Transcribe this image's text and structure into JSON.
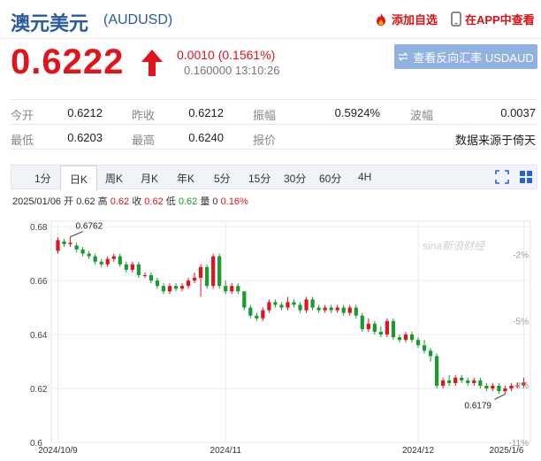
{
  "header": {
    "name": "澳元美元",
    "code": "(AUDUSD)",
    "add_favorite": "添加自选",
    "view_in_app": "在APP中查看"
  },
  "quote": {
    "price": "0.6222",
    "change": "0.0010 (0.1561%)",
    "time": "0.160000 13:10:26",
    "reverse_button": "查看反向汇率 USDAUD",
    "accent_color": "#e1141c"
  },
  "stats": [
    [
      {
        "label": "今开",
        "value": "0.6212"
      },
      {
        "label": "昨收",
        "value": "0.6212"
      },
      {
        "label": "振幅",
        "value": "0.5924%"
      },
      {
        "label": "波幅",
        "value": "0.0037"
      }
    ],
    [
      {
        "label": "最低",
        "value": "0.6203"
      },
      {
        "label": "最高",
        "value": "0.6240"
      },
      {
        "label": "报价",
        "value": ""
      },
      {
        "label": "",
        "value": "数据来源于倚天"
      }
    ]
  ],
  "tabs": [
    "1分",
    "日K",
    "周K",
    "月K",
    "年K",
    "5分",
    "15分",
    "30分",
    "60分",
    "4H"
  ],
  "active_tab": "日K",
  "info_bar": {
    "date": "2025/01/06",
    "open_label": "开",
    "open": "0.62",
    "high_label": "高",
    "high": "0.62",
    "close_label": "收",
    "close": "0.62",
    "low_label": "低",
    "low": "0.62",
    "volume_label": "量",
    "volume": "0",
    "change_pct": "0.16%"
  },
  "chart_data": {
    "type": "candlestick",
    "y_ticks": [
      "0.68",
      "0.66",
      "0.64",
      "0.62",
      "0.6"
    ],
    "right_ticks": [
      "-2%",
      "-5%",
      "-8%",
      "-11%"
    ],
    "x_labels": [
      "2024/10/9",
      "2024/11",
      "2024/12",
      "2025/1/6"
    ],
    "ylim": [
      0.6,
      0.682
    ],
    "max_label": "0.6762",
    "min_label": "0.6179",
    "watermark": "sina新浪财经",
    "up_color": "#e1141c",
    "down_color": "#1a9b30",
    "candles": [
      [
        0.671,
        0.675,
        0.67,
        0.676
      ],
      [
        0.6745,
        0.6735,
        0.6725,
        0.6755
      ],
      [
        0.6735,
        0.674,
        0.6725,
        0.6762
      ],
      [
        0.673,
        0.6715,
        0.6705,
        0.674
      ],
      [
        0.6715,
        0.67,
        0.669,
        0.6725
      ],
      [
        0.67,
        0.669,
        0.668,
        0.671
      ],
      [
        0.669,
        0.667,
        0.666,
        0.67
      ],
      [
        0.667,
        0.666,
        0.665,
        0.668
      ],
      [
        0.666,
        0.668,
        0.665,
        0.669
      ],
      [
        0.668,
        0.669,
        0.667,
        0.67
      ],
      [
        0.669,
        0.666,
        0.665,
        0.67
      ],
      [
        0.666,
        0.664,
        0.663,
        0.667
      ],
      [
        0.664,
        0.666,
        0.663,
        0.667
      ],
      [
        0.666,
        0.662,
        0.661,
        0.667
      ],
      [
        0.662,
        0.662,
        0.661,
        0.663
      ],
      [
        0.662,
        0.66,
        0.659,
        0.663
      ],
      [
        0.66,
        0.658,
        0.657,
        0.661
      ],
      [
        0.658,
        0.656,
        0.655,
        0.659
      ],
      [
        0.656,
        0.658,
        0.655,
        0.659
      ],
      [
        0.658,
        0.657,
        0.656,
        0.659
      ],
      [
        0.657,
        0.658,
        0.656,
        0.659
      ],
      [
        0.658,
        0.66,
        0.657,
        0.661
      ],
      [
        0.66,
        0.661,
        0.659,
        0.663
      ],
      [
        0.661,
        0.665,
        0.654,
        0.666
      ],
      [
        0.665,
        0.658,
        0.657,
        0.666
      ],
      [
        0.658,
        0.669,
        0.657,
        0.67
      ],
      [
        0.669,
        0.658,
        0.657,
        0.67
      ],
      [
        0.658,
        0.656,
        0.655,
        0.66
      ],
      [
        0.656,
        0.658,
        0.655,
        0.659
      ],
      [
        0.658,
        0.656,
        0.655,
        0.659
      ],
      [
        0.656,
        0.65,
        0.649,
        0.656
      ],
      [
        0.65,
        0.647,
        0.646,
        0.651
      ],
      [
        0.647,
        0.646,
        0.645,
        0.648
      ],
      [
        0.646,
        0.649,
        0.645,
        0.65
      ],
      [
        0.649,
        0.652,
        0.648,
        0.653
      ],
      [
        0.652,
        0.651,
        0.65,
        0.653
      ],
      [
        0.651,
        0.65,
        0.649,
        0.652
      ],
      [
        0.65,
        0.652,
        0.649,
        0.654
      ],
      [
        0.652,
        0.651,
        0.65,
        0.653
      ],
      [
        0.651,
        0.649,
        0.648,
        0.652
      ],
      [
        0.649,
        0.653,
        0.648,
        0.654
      ],
      [
        0.653,
        0.65,
        0.649,
        0.654
      ],
      [
        0.65,
        0.649,
        0.648,
        0.651
      ],
      [
        0.649,
        0.65,
        0.648,
        0.651
      ],
      [
        0.65,
        0.649,
        0.648,
        0.651
      ],
      [
        0.649,
        0.65,
        0.648,
        0.651
      ],
      [
        0.65,
        0.648,
        0.647,
        0.651
      ],
      [
        0.648,
        0.65,
        0.647,
        0.651
      ],
      [
        0.65,
        0.647,
        0.646,
        0.651
      ],
      [
        0.647,
        0.642,
        0.641,
        0.648
      ],
      [
        0.642,
        0.644,
        0.641,
        0.646
      ],
      [
        0.644,
        0.641,
        0.64,
        0.645
      ],
      [
        0.641,
        0.64,
        0.639,
        0.643
      ],
      [
        0.64,
        0.645,
        0.639,
        0.646
      ],
      [
        0.645,
        0.639,
        0.638,
        0.646
      ],
      [
        0.639,
        0.638,
        0.637,
        0.64
      ],
      [
        0.638,
        0.64,
        0.637,
        0.641
      ],
      [
        0.64,
        0.638,
        0.637,
        0.641
      ],
      [
        0.638,
        0.636,
        0.635,
        0.639
      ],
      [
        0.636,
        0.634,
        0.633,
        0.638
      ],
      [
        0.634,
        0.632,
        0.63,
        0.635
      ],
      [
        0.632,
        0.621,
        0.62,
        0.633
      ],
      [
        0.621,
        0.623,
        0.62,
        0.624
      ],
      [
        0.623,
        0.622,
        0.621,
        0.625
      ],
      [
        0.622,
        0.624,
        0.621,
        0.625
      ],
      [
        0.624,
        0.623,
        0.622,
        0.625
      ],
      [
        0.623,
        0.622,
        0.621,
        0.624
      ],
      [
        0.622,
        0.623,
        0.621,
        0.624
      ],
      [
        0.623,
        0.621,
        0.62,
        0.624
      ],
      [
        0.621,
        0.62,
        0.619,
        0.622
      ],
      [
        0.62,
        0.621,
        0.619,
        0.622
      ],
      [
        0.621,
        0.619,
        0.618,
        0.622
      ],
      [
        0.619,
        0.62,
        0.6179,
        0.621
      ],
      [
        0.62,
        0.621,
        0.619,
        0.622
      ],
      [
        0.621,
        0.6212,
        0.62,
        0.622
      ],
      [
        0.6212,
        0.6222,
        0.6203,
        0.624
      ]
    ]
  }
}
